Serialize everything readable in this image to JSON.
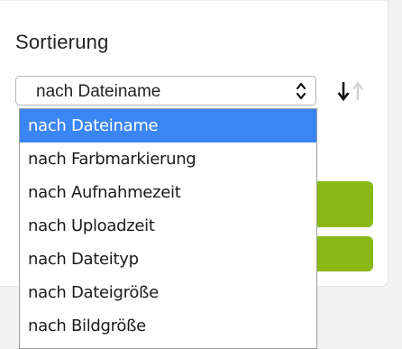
{
  "sort": {
    "title": "Sortierung",
    "selected_value": "nach Dateiname",
    "options": [
      "nach Dateiname",
      "nach Farbmarkierung",
      "nach Aufnahmezeit",
      "nach Uploadzeit",
      "nach Dateityp",
      "nach Dateigröße",
      "nach Bildgröße"
    ],
    "highlighted_index": 0
  },
  "icons": {
    "select_arrows": "up-down-chevrons-icon",
    "sort_direction": "sort-direction-icon"
  },
  "colors": {
    "highlight": "#3b86f7",
    "accent_green": "#8ab814"
  }
}
